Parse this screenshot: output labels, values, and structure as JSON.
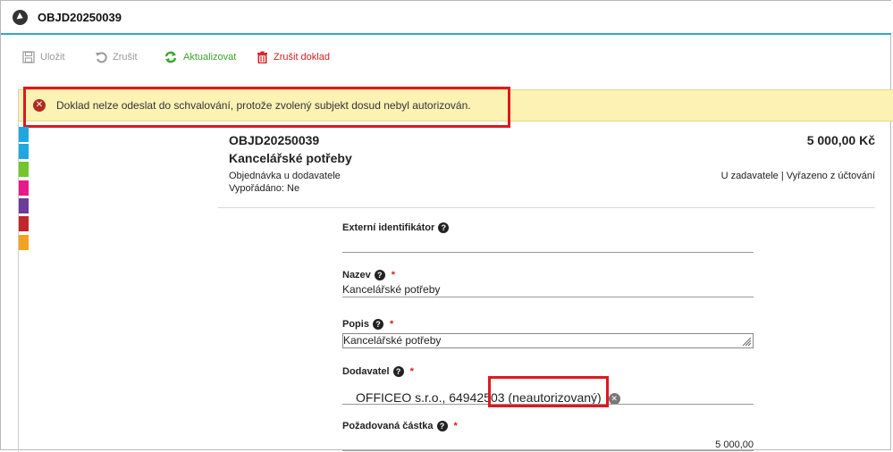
{
  "window": {
    "title": "OBJD20250039"
  },
  "toolbar": {
    "save_label": "Uložit",
    "cancel_label": "Zrušit",
    "refresh_label": "Aktualizovat",
    "delete_label": "Zrušit doklad"
  },
  "alert": {
    "message": "Doklad nelze odeslat do schvalování, protože zvolený subjekt dosud nebyl autorizován."
  },
  "colors": {
    "accent": "#2ea6d6",
    "alert_bg": "#fcf2b4",
    "highlight": "#e0171e",
    "side_tabs": [
      "#1fa8e0",
      "#1fa8e0",
      "#74c52c",
      "#e8178a",
      "#6a3d98",
      "#c2262d",
      "#f4a21d"
    ]
  },
  "document": {
    "id": "OBJD20250039",
    "name": "Kancelářské potřeby",
    "type": "Objednávka u dodavatele",
    "settled": "Vypořádáno: Ne",
    "amount": "5 000,00 Kč",
    "status": "U zadavatele | Vyřazeno z účtování"
  },
  "form": {
    "external_id": {
      "label": "Externí identifikátor",
      "value": ""
    },
    "name": {
      "label": "Nazev",
      "value": "Kancelářské potřeby",
      "required": "*"
    },
    "description": {
      "label": "Popis",
      "value": "Kancelářské potřeby",
      "required": "*"
    },
    "supplier": {
      "label": "Dodavatel",
      "value": "OFFICEO s.r.o., 64942503",
      "status": "(neautorizovaný)",
      "required": "*"
    },
    "amount": {
      "label": "Požadovaná částka",
      "value": "5 000,00",
      "required": "*"
    }
  },
  "icons": {
    "logo": "app-logo-icon",
    "save": "floppy-disk-icon",
    "cancel": "undo-icon",
    "refresh": "refresh-icon",
    "delete": "trash-icon",
    "alert": "error-circle-icon",
    "help": "help-circle-icon",
    "clear": "clear-circle-icon"
  }
}
